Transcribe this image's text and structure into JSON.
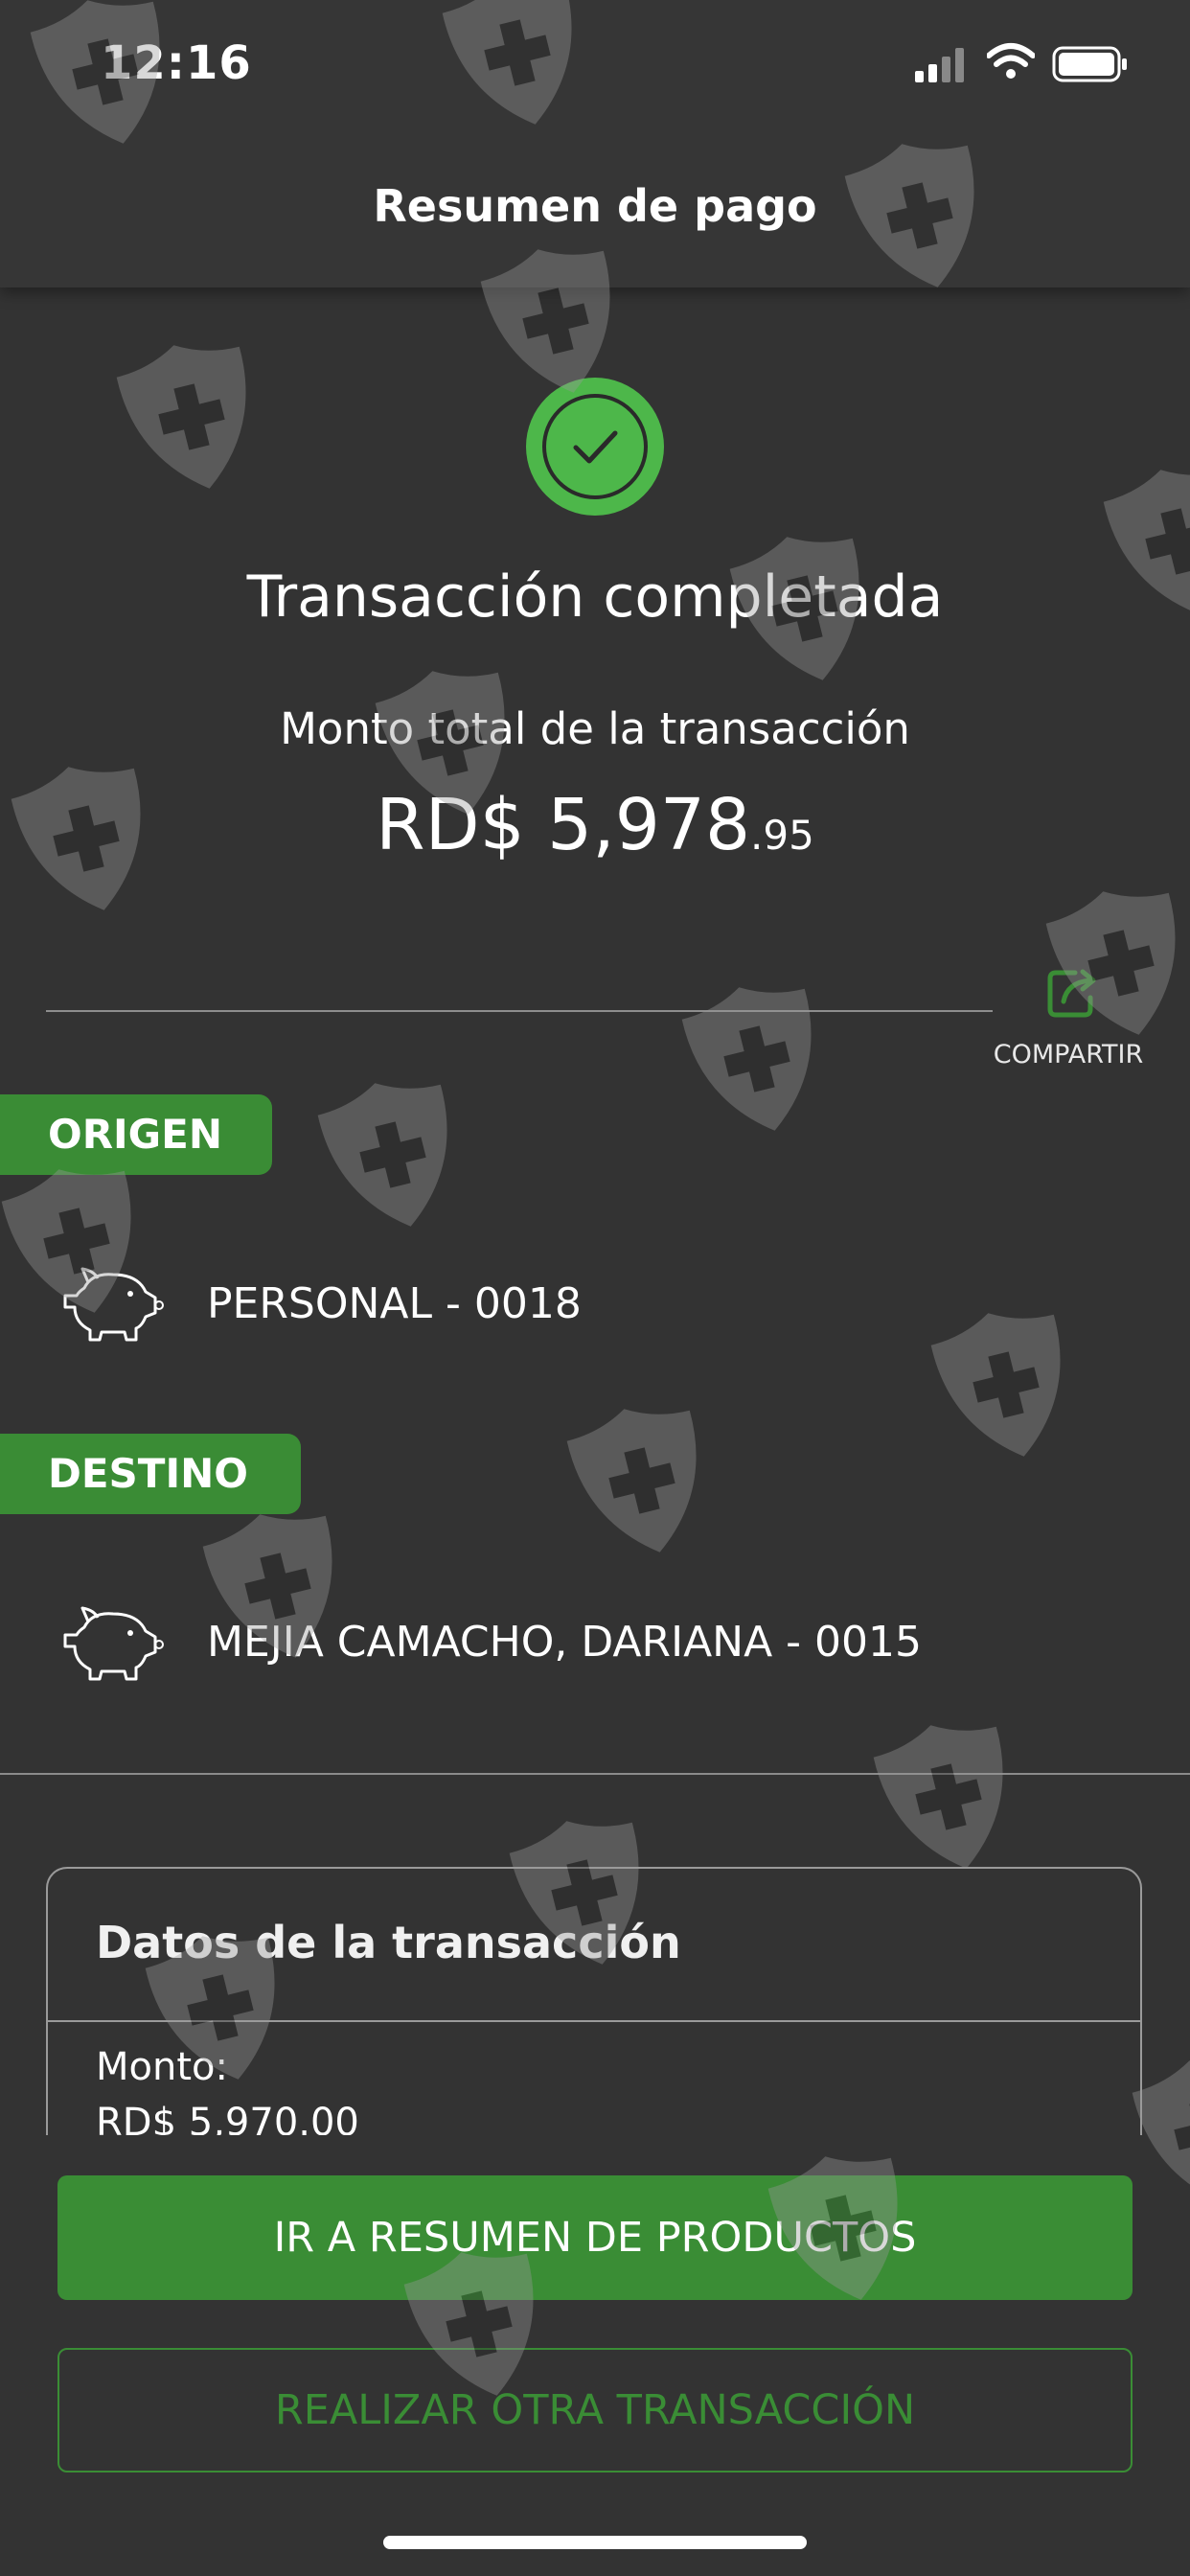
{
  "status_bar": {
    "time": "12:16"
  },
  "header": {
    "title": "Resumen de pago"
  },
  "result": {
    "title": "Transacción completada",
    "subtitle": "Monto total de la transacción",
    "amount_main": "RD$ 5,978",
    "amount_cents": ".95"
  },
  "share": {
    "label": "COMPARTIR"
  },
  "origin": {
    "label": "ORIGEN",
    "account": "PERSONAL - 0018",
    "icon": "piggy-bank-icon"
  },
  "destination": {
    "label": "DESTINO",
    "account": "MEJIA CAMACHO, DARIANA - 0015",
    "icon": "piggy-bank-icon"
  },
  "details": {
    "title": "Datos de la transacción",
    "amount_label": "Monto:",
    "amount_value": "RD$ 5,970.00"
  },
  "buttons": {
    "primary": "IR A RESUMEN DE PRODUCTOS",
    "secondary": "REALIZAR OTRA TRANSACCIÓN"
  },
  "colors": {
    "background": "#333333",
    "accent": "#3a8d35",
    "success": "#4db74a"
  }
}
